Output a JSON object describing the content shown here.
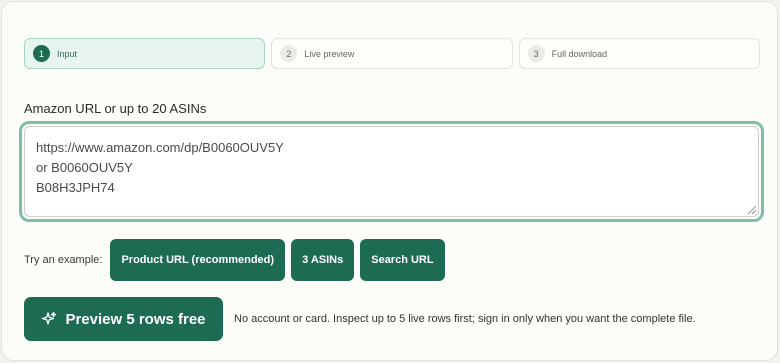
{
  "steps": [
    {
      "num": "1",
      "label": "Input",
      "active": true
    },
    {
      "num": "2",
      "label": "Live preview",
      "active": false
    },
    {
      "num": "3",
      "label": "Full download",
      "active": false
    }
  ],
  "input": {
    "label": "Amazon URL or up to 20 ASINs",
    "lines": [
      "https://www.amazon.com/dp/B0060OUV5Y",
      "or B0060OUV5Y",
      "B08H3JPH74"
    ]
  },
  "examples": {
    "label": "Try an example:",
    "chips": [
      "Product URL (recommended)",
      "3 ASINs",
      "Search URL"
    ]
  },
  "cta": {
    "label": "Preview 5 rows free",
    "icon": "sparkle-icon",
    "note": "No account or card. Inspect up to 5 live rows first; sign in only when you want the complete file."
  },
  "colors": {
    "accent": "#1d6b53",
    "focus_ring": "#7fbfaa",
    "active_step_bg": "#e8f4ef"
  }
}
